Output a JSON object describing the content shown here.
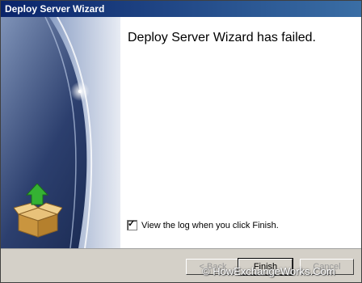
{
  "window": {
    "title": "Deploy Server Wizard"
  },
  "content": {
    "headline": "Deploy Server Wizard has failed.",
    "view_log_label": "View the log when you click Finish.",
    "view_log_checked": true
  },
  "footer": {
    "back_label": "< Back",
    "finish_label": "Finish",
    "cancel_label": "Cancel"
  },
  "watermark": {
    "text": "© HowExchangeWorks.Com"
  },
  "colors": {
    "title_bar": "#0a246a",
    "banner_dark": "#1c2e56",
    "banner_light": "#c9d4e8"
  }
}
